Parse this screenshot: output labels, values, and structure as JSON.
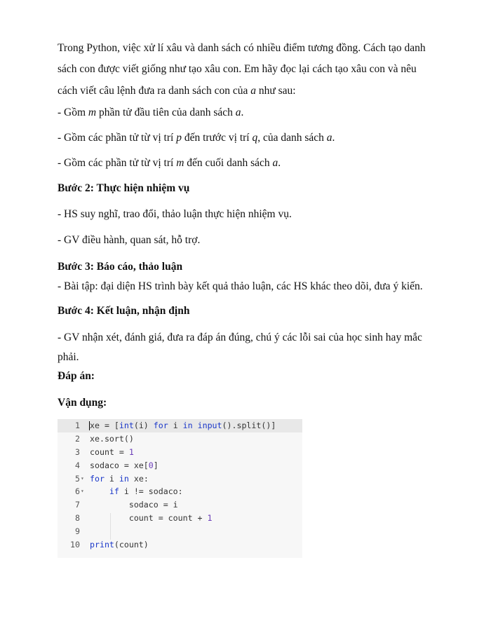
{
  "intro_lines": [
    "Trong Python, việc xử lí xâu và danh sách có nhiều điểm tương đồng. Cách tạo danh",
    "sách con được viết giống như tạo xâu con. Em hãy đọc lại cách tạo xâu con và nêu"
  ],
  "intro_last": {
    "pre": "cách viết câu lệnh đưa ra danh sách con của ",
    "it": "a",
    "post": " như sau:"
  },
  "item1": {
    "a": "- Gồm ",
    "b": "m",
    "c": " phần tử đầu tiên của danh sách ",
    "d": "a",
    "e": "."
  },
  "item2": {
    "a": "- Gồm các phần tử từ vị trí ",
    "b": "p",
    "c": " đến trước vị trí ",
    "d": "q",
    "e": ", của danh sách ",
    "f": "a",
    "g": "."
  },
  "item3": {
    "a": "- Gồm các phần tử từ vị trí ",
    "b": "m",
    "c": " đến cuối danh sách ",
    "d": "a",
    "e": "."
  },
  "step2": {
    "heading": "Bước 2: Thực hiện nhiệm vụ",
    "lines": [
      "- HS suy nghĩ, trao đổi, thảo luận thực hiện nhiệm vụ.",
      "- GV điều hành, quan sát, hỗ trợ."
    ]
  },
  "step3": {
    "heading": "Bước 3: Báo cáo, thảo luận",
    "line": "- Bài tập: đại diện HS trình bày kết quả thảo luận, các HS khác theo dõi, đưa ý kiến."
  },
  "step4": {
    "heading": "Bước 4: Kết luận, nhận định",
    "lines": [
      "- GV nhận xét, đánh giá, đưa ra đáp án đúng, chú ý các lỗi sai của học sinh hay mắc",
      "phải."
    ]
  },
  "answer_label": "Đáp án:",
  "apply_label": "Vận dụng:",
  "code": {
    "fold_icon": "▾",
    "lines": [
      {
        "n": "1",
        "fold": false,
        "tokens": [
          [
            "",
            "xe = ["
          ],
          [
            "kw",
            "int"
          ],
          [
            "",
            "(i) "
          ],
          [
            "kw",
            "for"
          ],
          [
            "",
            " i "
          ],
          [
            "kw",
            "in"
          ],
          [
            "",
            ""
          ],
          [
            "kw",
            " input"
          ],
          [
            "",
            "().split()]"
          ]
        ]
      },
      {
        "n": "2",
        "fold": false,
        "tokens": [
          [
            "",
            "xe.sort()"
          ]
        ]
      },
      {
        "n": "3",
        "fold": false,
        "tokens": [
          [
            "",
            "count = "
          ],
          [
            "nm",
            "1"
          ]
        ]
      },
      {
        "n": "4",
        "fold": false,
        "tokens": [
          [
            "",
            "sodaco = xe["
          ],
          [
            "nm",
            "0"
          ],
          [
            "",
            "]"
          ]
        ]
      },
      {
        "n": "5",
        "fold": true,
        "tokens": [
          [
            "kw",
            "for"
          ],
          [
            "",
            " i "
          ],
          [
            "kw",
            "in"
          ],
          [
            "",
            " xe:"
          ]
        ]
      },
      {
        "n": "6",
        "fold": true,
        "tokens": [
          [
            "",
            "    "
          ],
          [
            "kw",
            "if"
          ],
          [
            "",
            " i != sodaco:"
          ]
        ]
      },
      {
        "n": "7",
        "fold": false,
        "tokens": [
          [
            "",
            "        sodaco = i"
          ]
        ]
      },
      {
        "n": "8",
        "fold": false,
        "tokens": [
          [
            "",
            "        count = count + "
          ],
          [
            "nm",
            "1"
          ]
        ]
      },
      {
        "n": "9",
        "fold": false,
        "tokens": []
      },
      {
        "n": "10",
        "fold": false,
        "tokens": [
          [
            "kw",
            "print"
          ],
          [
            "",
            "(count)"
          ]
        ]
      }
    ]
  }
}
